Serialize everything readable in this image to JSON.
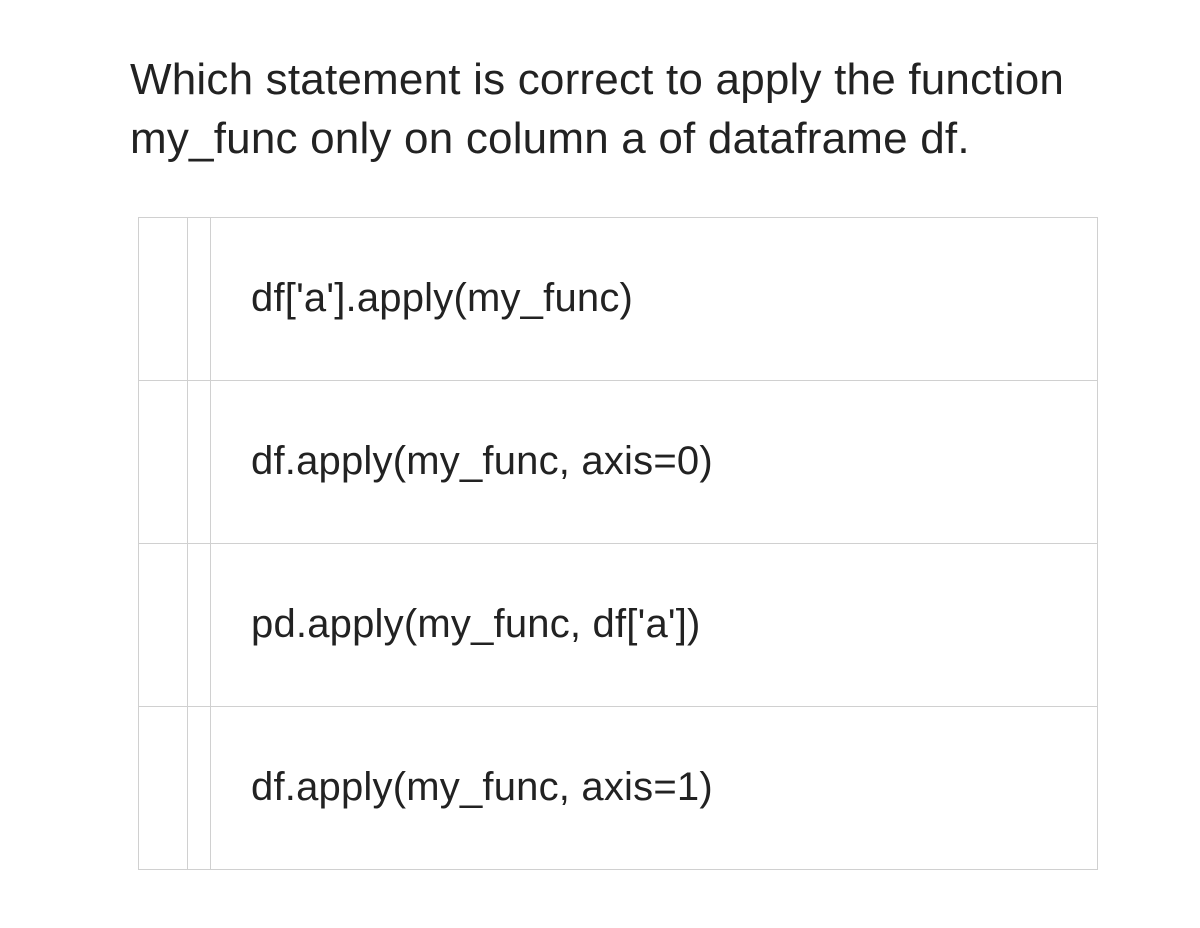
{
  "question": "Which statement is correct to apply the function my_func only on column a of dataframe df.",
  "options": [
    {
      "text": "df['a'].apply(my_func)"
    },
    {
      "text": "df.apply(my_func, axis=0)"
    },
    {
      "text": "pd.apply(my_func, df['a'])"
    },
    {
      "text": "df.apply(my_func, axis=1)"
    }
  ]
}
